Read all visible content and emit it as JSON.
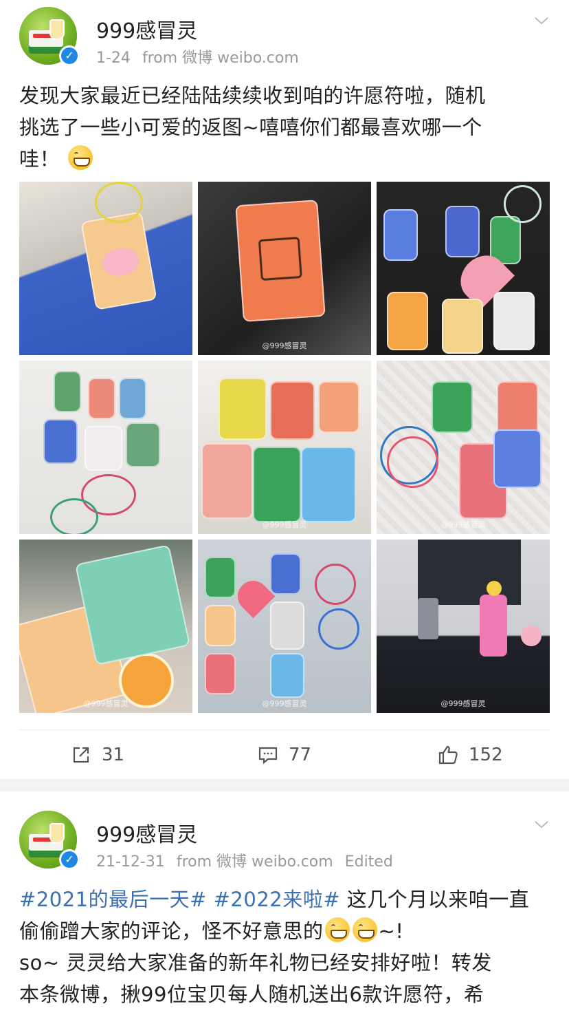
{
  "posts": [
    {
      "author": "999感冒灵",
      "verified": "✓",
      "date": "1-24",
      "source": "from 微博 weibo.com",
      "edited": "",
      "text_lines": [
        "发现大家最近已经陆陆续续收到咱的许愿符啦，随机",
        "挑选了一些小可爱的返图~嘻嘻你们都最喜欢哪一个",
        "哇！"
      ],
      "photos": [
        {
          "desc": "keychain-pig-on-bag"
        },
        {
          "desc": "keychain-gift-on-black-bag"
        },
        {
          "desc": "keychains-on-dark-table"
        },
        {
          "desc": "keychains-on-white-paper"
        },
        {
          "desc": "keychains-pile"
        },
        {
          "desc": "keychains-with-rings"
        },
        {
          "desc": "keychains-in-hand"
        },
        {
          "desc": "keychains-on-grey-table"
        },
        {
          "desc": "figurines-on-desk"
        }
      ],
      "watermark": "@999感冒灵",
      "actions": {
        "repost": "31",
        "comment": "77",
        "like": "152"
      }
    },
    {
      "author": "999感冒灵",
      "verified": "✓",
      "date": "21-12-31",
      "source": "from 微博 weibo.com",
      "edited": "Edited",
      "hashtag1": "#2021的最后一天#",
      "hashtag2": "#2022来啦#",
      "line1_rest": " 这几个月以来咱一直",
      "line2": "偷偷蹭大家的评论，怪不好意思的",
      "line2_end": "~!",
      "line3": "so~ 灵灵给大家准备的新年礼物已经安排好啦！转发",
      "line4": "本条微博，揪99位宝贝每人随机送出6款许愿符，希"
    }
  ],
  "colors": {
    "hashtag": "#3d6fb3",
    "verified": "#1e88e5",
    "meta": "#9a9a9a"
  }
}
